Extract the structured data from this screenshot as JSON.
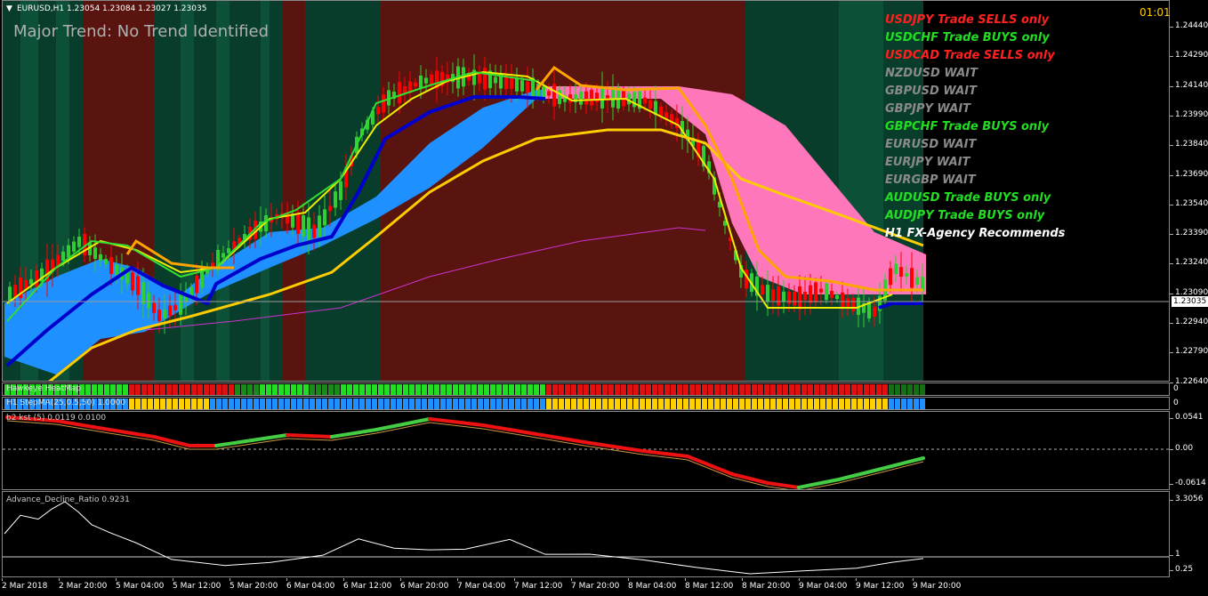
{
  "header": {
    "symbol_line": "EURUSD,H1  1.23054 1.23084 1.23027 1.23035",
    "trend": "Major Trend: No Trend Identified",
    "clock": "01:01"
  },
  "recommendations": [
    {
      "text": "USDJPY Trade SELLS only",
      "color": "#ff2020"
    },
    {
      "text": "USDCHF Trade BUYS only",
      "color": "#22dd22"
    },
    {
      "text": "USDCAD Trade SELLS only",
      "color": "#ff2020"
    },
    {
      "text": "NZDUSD WAIT",
      "color": "#8a8a8a"
    },
    {
      "text": "GBPUSD WAIT",
      "color": "#8a8a8a"
    },
    {
      "text": "GBPJPY WAIT",
      "color": "#8a8a8a"
    },
    {
      "text": "GBPCHF Trade BUYS only",
      "color": "#22dd22"
    },
    {
      "text": "EURUSD WAIT",
      "color": "#8a8a8a"
    },
    {
      "text": "EURJPY WAIT",
      "color": "#8a8a8a"
    },
    {
      "text": "EURGBP WAIT",
      "color": "#8a8a8a"
    },
    {
      "text": "AUDUSD Trade BUYS only",
      "color": "#22dd22"
    },
    {
      "text": "AUDJPY Trade BUYS only",
      "color": "#22dd22"
    },
    {
      "text": "H1 FX-Agency Recommends",
      "color": "#ffffff"
    }
  ],
  "price_axis": {
    "ticks": [
      "1.24440",
      "1.24290",
      "1.24140",
      "1.23990",
      "1.23840",
      "1.23690",
      "1.23540",
      "1.23390",
      "1.23240",
      "1.23090",
      "1.22940",
      "1.22790",
      "1.22640"
    ],
    "current_price": "1.23035"
  },
  "indicators": {
    "heatmap_label": "Hawkeye HeatMap",
    "stepma_label": "H1 StepMA(25,0.5,50) 1.0000",
    "osc_label": "b2 kst (5) 0.0119  0.0100",
    "osc_ticks": [
      "0.0541",
      "0.00",
      "-0.0614"
    ],
    "adr_label": "Advance_Decline_Ratio 0.9231",
    "adr_ticks": [
      "3.3056",
      "1",
      "0.25"
    ],
    "heatmap_right_value": "0",
    "stepma_right_value": "0"
  },
  "time_axis": [
    "2 Mar 2018",
    "2 Mar 20:00",
    "5 Mar 04:00",
    "5 Mar 12:00",
    "5 Mar 20:00",
    "6 Mar 04:00",
    "6 Mar 12:00",
    "6 Mar 20:00",
    "7 Mar 04:00",
    "7 Mar 12:00",
    "7 Mar 20:00",
    "8 Mar 04:00",
    "8 Mar 12:00",
    "8 Mar 20:00",
    "9 Mar 04:00",
    "9 Mar 12:00",
    "9 Mar 20:00"
  ],
  "colors": {
    "bull_candle": "#32cd32",
    "bear_candle": "#ff0000",
    "up_band": "#1e90ff",
    "down_band": "#ff77bb",
    "green_zone": "#083d2b",
    "red_zone": "#5a1410",
    "ma_yellow": "#ffcc00",
    "ma_orange": "#ffa500",
    "ma_magenta": "#cc33cc",
    "ma_blue": "#0000cc"
  }
}
